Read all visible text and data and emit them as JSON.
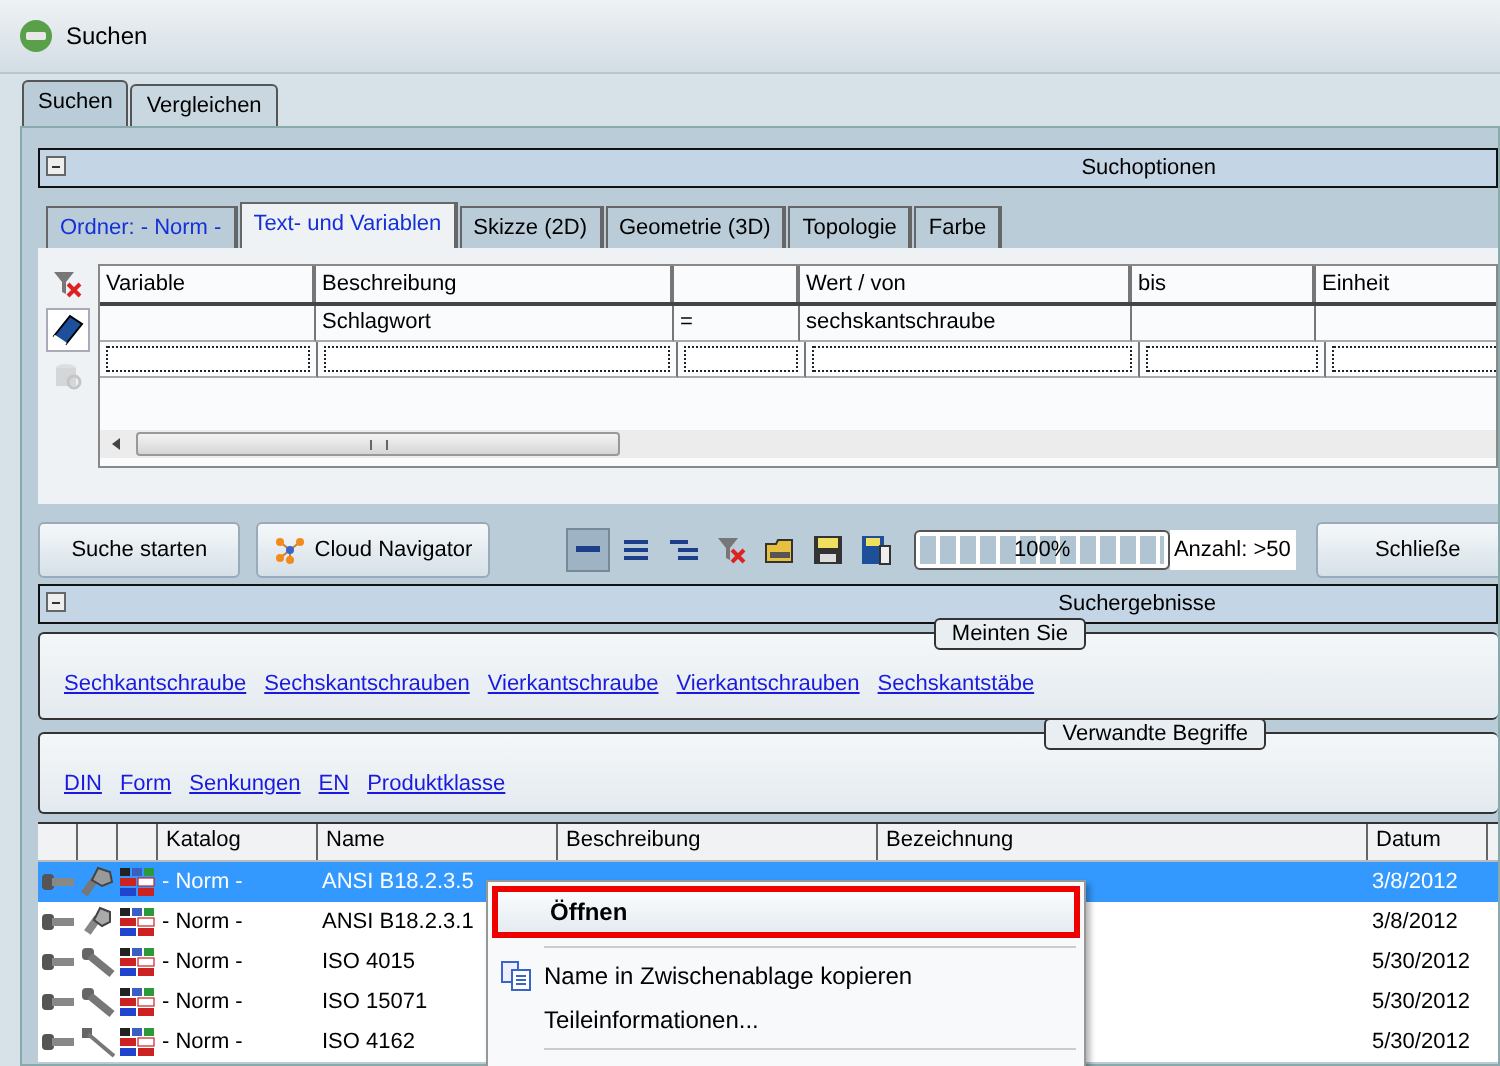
{
  "window": {
    "title": "Suchen"
  },
  "main_tabs": [
    {
      "label": "Suchen",
      "selected": true
    },
    {
      "label": "Vergleichen",
      "selected": false
    }
  ],
  "search_options": {
    "title": "Suchoptionen",
    "tabs": [
      {
        "label": "Ordner: - Norm -",
        "selected": false,
        "highlight": true
      },
      {
        "label": "Text- und Variablen",
        "selected": true,
        "highlight": true
      },
      {
        "label": "Skizze (2D)",
        "selected": false,
        "highlight": false
      },
      {
        "label": "Geometrie (3D)",
        "selected": false,
        "highlight": false
      },
      {
        "label": "Topologie",
        "selected": false,
        "highlight": false
      },
      {
        "label": "Farbe",
        "selected": false,
        "highlight": false
      }
    ],
    "side_tools": [
      {
        "kind": "filter-clear",
        "selected": false,
        "disabled": false
      },
      {
        "kind": "book",
        "selected": true,
        "disabled": false
      },
      {
        "kind": "database",
        "selected": false,
        "disabled": true
      }
    ],
    "columns": [
      "Variable",
      "Beschreibung",
      "",
      "Wert / von",
      "bis",
      "Einheit"
    ],
    "rows": [
      [
        "",
        "Schlagwort",
        "=",
        "sechskantschraube",
        "",
        ""
      ]
    ]
  },
  "toolbar": {
    "buttons": [
      {
        "kind": "plain",
        "label": "Suche starten"
      },
      {
        "kind": "cloud",
        "label": "Cloud Navigator"
      }
    ],
    "view_icons": [
      {
        "kind": "lines-one",
        "selected": true
      },
      {
        "kind": "lines-three",
        "selected": false
      },
      {
        "kind": "lines-indent",
        "selected": false
      },
      {
        "kind": "filter-clear",
        "selected": false
      },
      {
        "kind": "folder",
        "selected": false
      },
      {
        "kind": "save",
        "selected": false
      },
      {
        "kind": "save-list",
        "selected": false
      }
    ],
    "progress": {
      "level": 1,
      "reading": "100%"
    },
    "count": "Anzahl: >50",
    "close_label": "Schließe"
  },
  "results": {
    "title": "Suchergebnisse",
    "suggestions": {
      "title": "Meinten Sie",
      "links": [
        "Sechkantschraube",
        "Sechskantschrauben",
        "Vierkantschraube",
        "Vierkantschrauben",
        "Sechskantstäbe"
      ]
    },
    "related": {
      "title": "Verwandte Begriffe",
      "links": [
        "DIN",
        "Form",
        "Senkungen",
        "EN",
        "Produktklasse"
      ]
    },
    "columns": [
      "",
      "",
      "",
      "Katalog",
      "Name",
      "Beschreibung",
      "Bezeichnung",
      "Datum"
    ],
    "rows": [
      {
        "selected": true,
        "kind": "hex",
        "katalog": "- Norm -",
        "name": "ANSI B18.2.3.5",
        "datum": "3/8/2012"
      },
      {
        "selected": false,
        "kind": "hex-short",
        "katalog": "- Norm -",
        "name": "ANSI B18.2.3.1",
        "datum": "3/8/2012"
      },
      {
        "selected": false,
        "kind": "socket",
        "katalog": "- Norm -",
        "name": "ISO 4015",
        "datum": "5/30/2012"
      },
      {
        "selected": false,
        "kind": "socket",
        "katalog": "- Norm -",
        "name": "ISO 15071",
        "datum": "5/30/2012"
      },
      {
        "selected": false,
        "kind": "long",
        "katalog": "- Norm -",
        "name": "ISO 4162",
        "datum": "5/30/2012"
      }
    ]
  },
  "context_menu": [
    {
      "kind": "item",
      "label": "Öffnen",
      "selected": true,
      "icon": false
    },
    {
      "kind": "separator"
    },
    {
      "kind": "item",
      "label": "Name in Zwischenablage kopieren",
      "selected": false,
      "icon": true
    },
    {
      "kind": "item",
      "label": "Teileinformationen...",
      "selected": false,
      "icon": false
    },
    {
      "kind": "separator"
    }
  ]
}
